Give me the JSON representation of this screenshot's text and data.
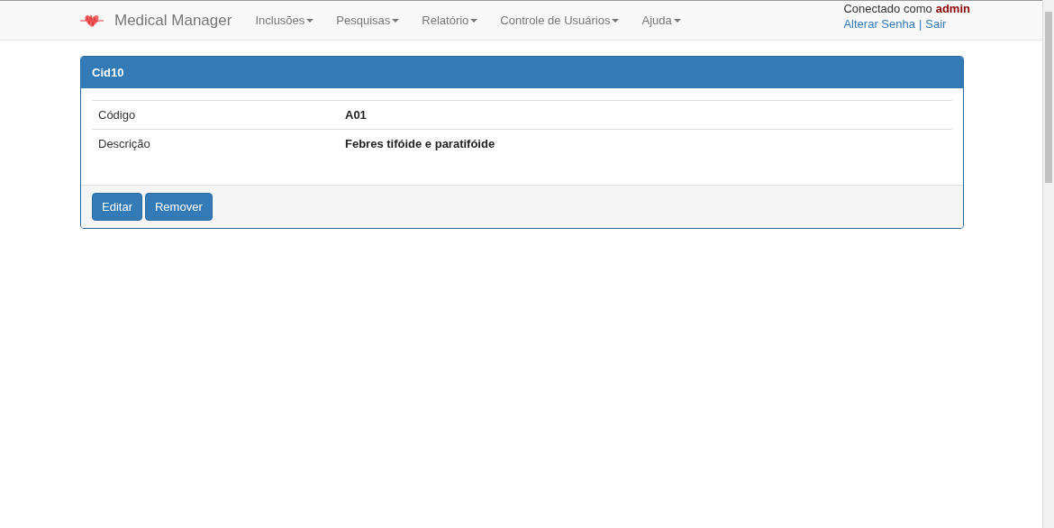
{
  "navbar": {
    "brand": "Medical Manager",
    "menus": [
      {
        "label": "Inclusões"
      },
      {
        "label": "Pesquisas"
      },
      {
        "label": "Relatório"
      },
      {
        "label": "Controle de Usuários"
      },
      {
        "label": "Ajuda"
      }
    ],
    "session": {
      "label": "Conectado como",
      "user": "admin",
      "links": [
        "Alterar Senha",
        "Sair"
      ],
      "separator": "|"
    }
  },
  "panel": {
    "title": "Cid10",
    "rows": [
      {
        "label": "Código",
        "value": "A01"
      },
      {
        "label": "Descrição",
        "value": "Febres tifóide e paratifóide"
      }
    ],
    "buttons": [
      "Editar",
      "Remover"
    ]
  }
}
